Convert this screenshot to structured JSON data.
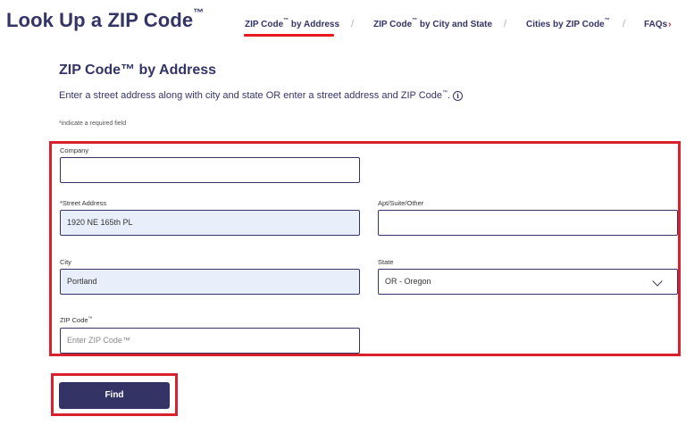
{
  "header": {
    "title": "Look Up a ZIP Code",
    "title_tm": "™"
  },
  "nav": {
    "items": [
      {
        "label": "ZIP Code",
        "tm": "™",
        "suffix": " by Address"
      },
      {
        "label": "ZIP Code",
        "tm": "™",
        "suffix": " by City and State"
      },
      {
        "label": "Cities by ZIP Code",
        "tm": "™",
        "suffix": ""
      },
      {
        "label": "FAQs",
        "tm": "",
        "suffix": ""
      }
    ],
    "separator": "/",
    "faq_chevron": "›"
  },
  "main": {
    "section_title": "ZIP Code™ by Address",
    "description": "Enter a street address along with city and state OR enter a street address and ZIP Code",
    "description_tm": "™",
    "description_end": ".",
    "info_icon_glyph": "i",
    "required_note": "*indicate a required field"
  },
  "form": {
    "company": {
      "label": "Company",
      "value": ""
    },
    "street": {
      "label": "*Street Address",
      "value": "1920 NE 165th PL"
    },
    "apt": {
      "label": "Apt/Suite/Other",
      "value": ""
    },
    "city": {
      "label": "City",
      "value": "Portland"
    },
    "state": {
      "label": "State",
      "value": "OR - Oregon"
    },
    "zip": {
      "label": "ZIP Code",
      "label_tm": "™",
      "value": "",
      "placeholder": "Enter ZIP Code™"
    }
  },
  "actions": {
    "find_label": "Find"
  },
  "colors": {
    "brand_navy": "#333366",
    "highlight_red": "#d9202c",
    "filled_bg": "#e8eefa",
    "active_underline": "#e71921"
  }
}
